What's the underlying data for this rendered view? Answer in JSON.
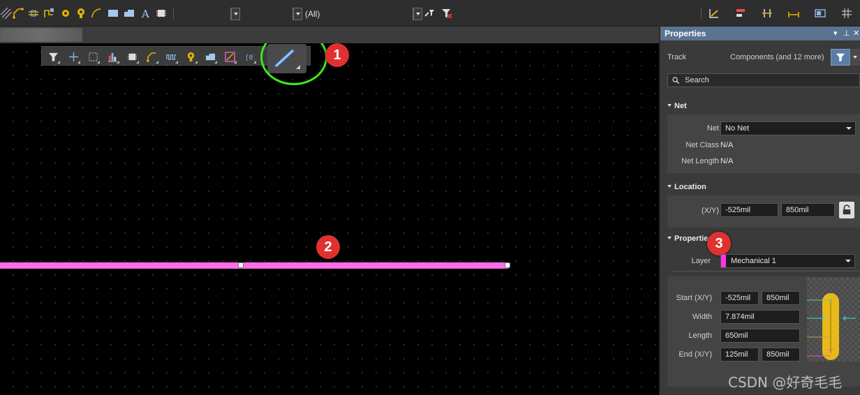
{
  "toolbar": {
    "filter_combo_value": "(All)",
    "icons": [
      "diagonal-hatch-icon",
      "interactive-route-icon",
      "differential-pair-icon",
      "multi-route-icon",
      "via-icon",
      "pad-icon",
      "arc-icon",
      "fill-icon",
      "region-icon",
      "text-icon",
      "component-icon",
      "select-filter-icon",
      "clear-filter-icon",
      "snap-icon",
      "align-icon",
      "distribute-icon",
      "dimension-icon",
      "room-icon",
      "grid-icon"
    ]
  },
  "canvas": {
    "active_bar_icons": [
      "filter-icon",
      "add-icon",
      "select-rect-icon",
      "chart-icon",
      "component-icon",
      "route-icon",
      "length-tune-icon",
      "pad-icon",
      "region-icon",
      "line-icon",
      "fabrication-icon",
      "track-icon"
    ],
    "badges": [
      "1",
      "2",
      "3"
    ],
    "track_color": "#ff6ee8",
    "highlight_color": "#3ee81e"
  },
  "panel": {
    "title": "Properties",
    "object_type": "Track",
    "selection_summary": "Components (and 12 more)",
    "search_placeholder": "Search",
    "net_section": {
      "title": "Net",
      "net_label": "Net",
      "net_value": "No Net",
      "net_class_label": "Net Class",
      "net_class_value": "N/A",
      "net_length_label": "Net Length",
      "net_length_value": "N/A"
    },
    "location_section": {
      "title": "Location",
      "xy_label": "(X/Y)",
      "x": "-525mil",
      "y": "850mil"
    },
    "properties_section": {
      "title": "Properties",
      "layer_label": "Layer",
      "layer_value": "Mechanical 1",
      "layer_color": "#ff37e3",
      "start_label": "Start (X/Y)",
      "start_x": "-525mil",
      "start_y": "850mil",
      "width_label": "Width",
      "width_value": "7.874mil",
      "length_label": "Length",
      "length_value": "650mil",
      "end_label": "End (X/Y)",
      "end_x": "125mil",
      "end_y": "850mil"
    }
  },
  "watermark": "CSDN @好奇毛毛"
}
